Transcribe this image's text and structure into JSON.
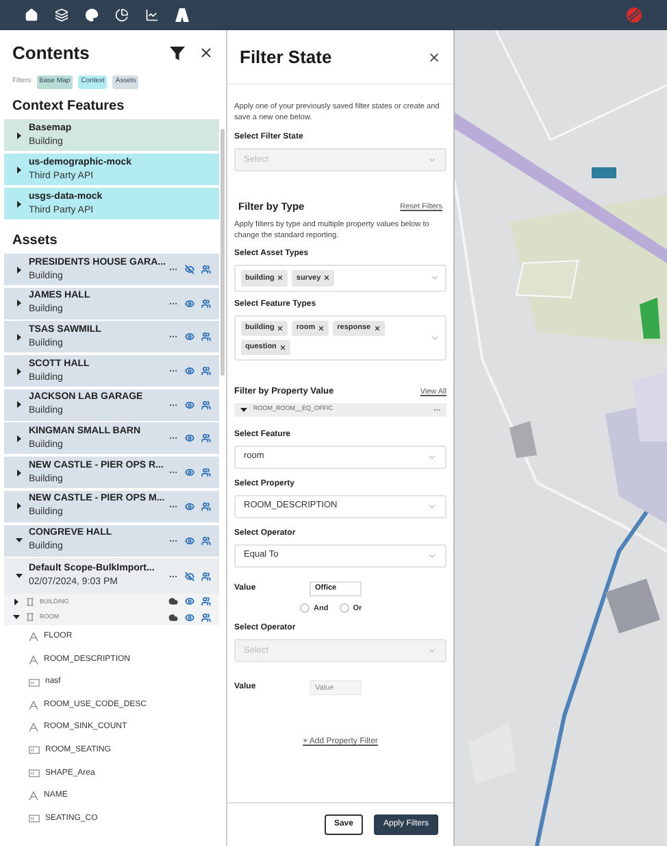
{
  "contents": {
    "title": "Contents",
    "filters_label": "Filters",
    "filter_chips": [
      {
        "label": "Base Map",
        "color": "#b9dcd6"
      },
      {
        "label": "Context",
        "color": "#b2ebf2"
      },
      {
        "label": "Assets",
        "color": "#d5dde5"
      }
    ],
    "context_heading": "Context Features",
    "context_features": [
      {
        "name": "Basemap",
        "subtitle": "Building",
        "color": "#d3e7e1",
        "expanded": false
      },
      {
        "name": "us-demographic-mock",
        "subtitle": "Third Party API",
        "color": "#b2ebf2",
        "expanded": false
      },
      {
        "name": "usgs-data-mock",
        "subtitle": "Third Party API",
        "color": "#b2ebf2",
        "expanded": false
      }
    ],
    "assets_heading": "Assets",
    "assets": [
      {
        "name": "PRESIDENTS HOUSE GARA...",
        "subtitle": "Building",
        "expanded": false,
        "visible": false
      },
      {
        "name": "JAMES HALL",
        "subtitle": "Building",
        "expanded": false,
        "visible": true
      },
      {
        "name": "TSAS SAWMILL",
        "subtitle": "Building",
        "expanded": false,
        "visible": true
      },
      {
        "name": "SCOTT HALL",
        "subtitle": "Building",
        "expanded": false,
        "visible": true
      },
      {
        "name": "JACKSON LAB GARAGE",
        "subtitle": "Building",
        "expanded": false,
        "visible": true
      },
      {
        "name": "KINGMAN SMALL BARN",
        "subtitle": "Building",
        "expanded": false,
        "visible": true
      },
      {
        "name": "NEW CASTLE - PIER OPS R...",
        "subtitle": "Building",
        "expanded": false,
        "visible": true
      },
      {
        "name": "NEW CASTLE - PIER OPS M...",
        "subtitle": "Building",
        "expanded": false,
        "visible": true
      },
      {
        "name": "CONGREVE HALL",
        "subtitle": "Building",
        "expanded": true,
        "visible": true
      }
    ],
    "scope": {
      "name": "Default Scope-BulkImport...",
      "date": "02/07/2024, 9:03 PM",
      "expanded": true,
      "visible": false,
      "layers": [
        {
          "label": "BUILDING",
          "expanded": false
        },
        {
          "label": "ROOM",
          "expanded": true
        }
      ],
      "fields": [
        {
          "name": "FLOOR",
          "kind": "text"
        },
        {
          "name": "ROOM_DESCRIPTION",
          "kind": "text"
        },
        {
          "name": "nasf",
          "kind": "number"
        },
        {
          "name": "ROOM_USE_CODE_DESC",
          "kind": "text"
        },
        {
          "name": "ROOM_SINK_COUNT",
          "kind": "text"
        },
        {
          "name": "ROOM_SEATING",
          "kind": "number"
        },
        {
          "name": "SHAPE_Area",
          "kind": "number"
        },
        {
          "name": "NAME",
          "kind": "text"
        },
        {
          "name": "SEATING_CO",
          "kind": "number"
        }
      ]
    }
  },
  "filter_state": {
    "title": "Filter State",
    "intro": "Apply one of your previously saved filter states or create and save a new one below.",
    "state_label": "Select Filter State",
    "state_placeholder": "Select",
    "type_heading": "Filter by Type",
    "reset_link": "Reset Filters",
    "type_description": "Apply filters by type and multiple property values below to change the standard reporting.",
    "asset_types_label": "Select Asset Types",
    "asset_types": [
      "building",
      "survey"
    ],
    "feature_types_label": "Select Feature Types",
    "feature_types": [
      "building",
      "room",
      "response",
      "question"
    ],
    "property_heading": "Filter by Property Value",
    "view_all_link": "View All",
    "group": {
      "label": "ROOM_ROOM__EQ_OFFIC",
      "expanded": true
    },
    "feature_label": "Select Feature",
    "feature_value": "room",
    "property_label": "Select Property",
    "property_value": "ROOM_DESCRIPTION",
    "operator_label": "Select Operator",
    "operator_value": "Equal To",
    "value_label": "Value",
    "value": "Office",
    "logic": [
      {
        "label": "And",
        "selected": false
      },
      {
        "label": "Or",
        "selected": false
      }
    ],
    "operator2_label": "Select Operator",
    "operator2_placeholder": "Select",
    "operator2_disabled": true,
    "value2_label": "Value",
    "value2_placeholder": "Value",
    "add_filter": "+ Add Property Filter",
    "buttons": [
      {
        "label": "Save",
        "kind": "secondary"
      },
      {
        "label": "Apply Filters",
        "kind": "primary"
      }
    ]
  }
}
